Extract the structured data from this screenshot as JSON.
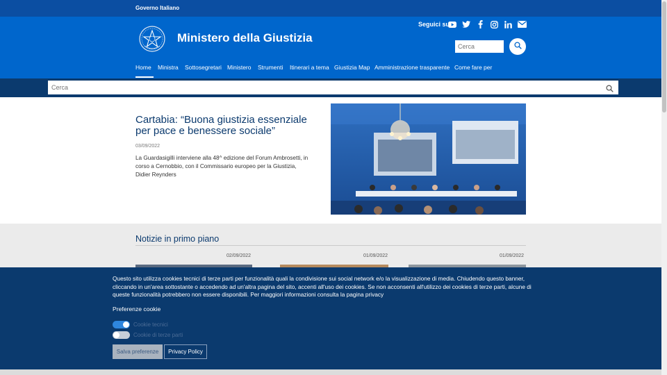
{
  "top_bar": {
    "label": "Governo Italiano"
  },
  "header": {
    "title": "Ministero della Giustizia",
    "social_label": "Seguici su",
    "social_icons": [
      "youtube-icon",
      "twitter-icon",
      "facebook-icon",
      "instagram-icon",
      "linkedin-icon",
      "mail-icon"
    ],
    "search_placeholder": "Cerca"
  },
  "nav": {
    "items": [
      "Home",
      "Ministra",
      "Sottosegretari",
      "Ministero",
      "Strumenti",
      "Itinerari a tema",
      "Giustizia Map",
      "Amministrazione trasparente",
      "Come fare per"
    ],
    "active": "Home"
  },
  "search_band": {
    "placeholder": "Cerca"
  },
  "hero": {
    "title": "Cartabia: “Buona giustizia essenziale per pace e benessere sociale”",
    "date": "03/09/2022",
    "description": "La Guardasigilli interviene alla 48^ edizione del Forum Ambrosetti, in corso a Cernobbio, con il Commissario europeo per la Giustizia, Didier Reynders"
  },
  "news": {
    "heading": "Notizie in primo piano",
    "dates": [
      "02/09/2022",
      "01/09/2022",
      "01/09/2022"
    ]
  },
  "cookie_banner": {
    "text": "Questo sito utilizza cookies tecnici di terze parti per funzionalità quali la condivisione sui social network e/o la visualizzazione di media. Chiudendo questo banner, cliccando in un'area sottostante o accedendo ad un'altra pagina del sito, accenti all'uso dei cookies. Se non acconsenti all'utilizzo dei cookies di terze parti, alcune di queste funzionalità potrebbero non essere disponibili. Per maggiori informazioni consulta la pagina privacy",
    "preferences_title": "Preferenze cookie",
    "toggle_technical": "Cookie tecnici",
    "toggle_third_party": "Cookie di terze parti",
    "save_button": "Salva preferenze",
    "privacy_button": "Privacy Policy"
  },
  "colors": {
    "slim_header": "#0b4ea2",
    "primary": "#0066cc",
    "dark": "#0b3a6e",
    "section_bg": "#ebebeb"
  }
}
